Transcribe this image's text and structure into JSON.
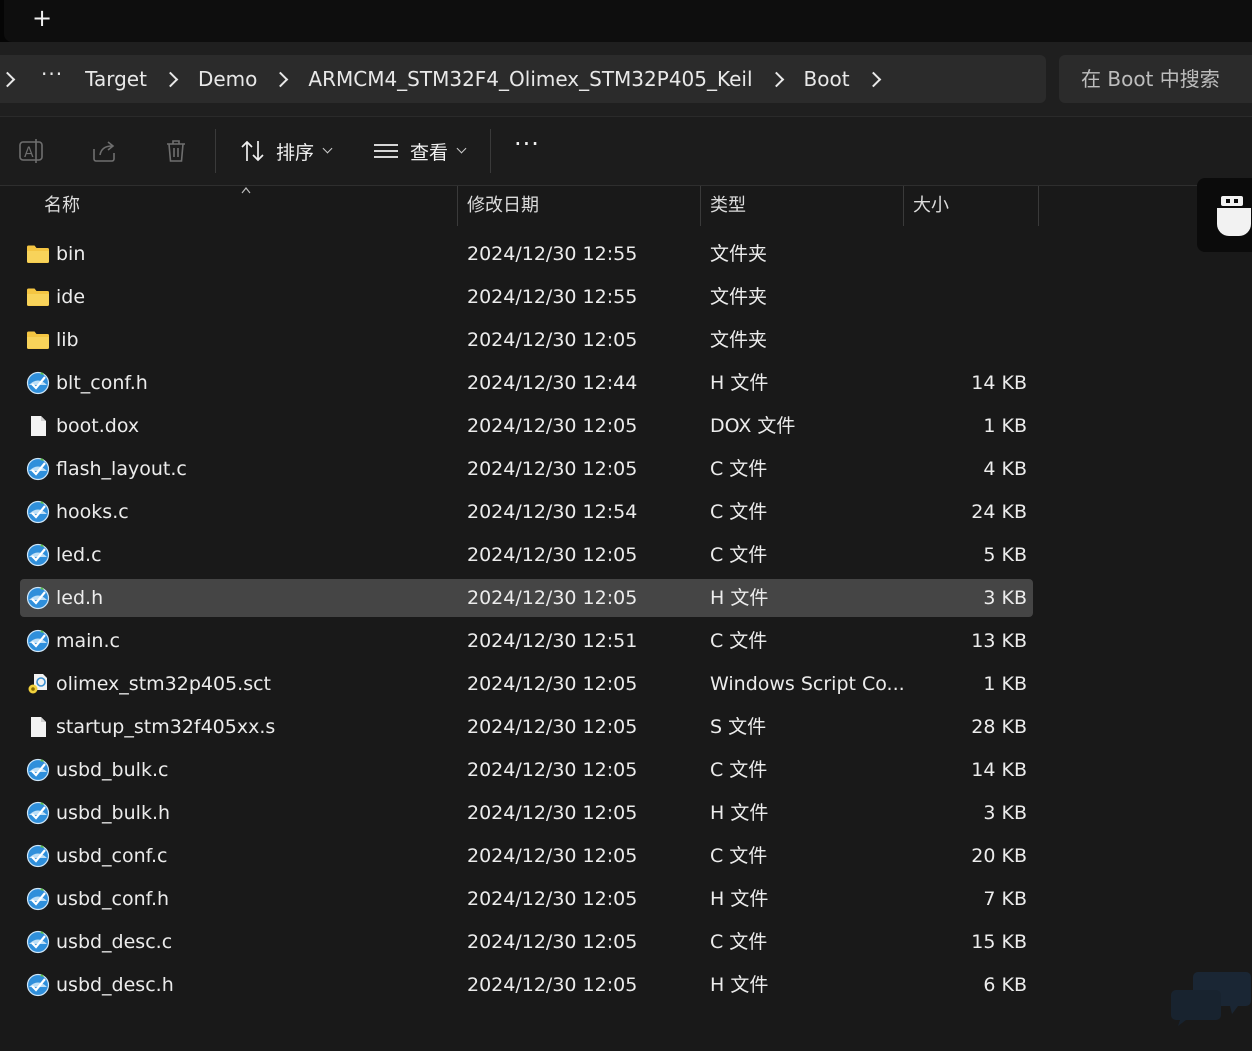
{
  "titlebar": {
    "new_tab_label": "+"
  },
  "breadcrumb": {
    "more": "···",
    "items": [
      "Target",
      "Demo",
      "ARMCM4_STM32F4_Olimex_STM32P405_Keil",
      "Boot"
    ]
  },
  "search": {
    "placeholder": "在 Boot 中搜索"
  },
  "toolbar": {
    "rename_icon": "rename-icon",
    "share_icon": "share-icon",
    "delete_icon": "trash-icon",
    "sort_label": "排序",
    "view_label": "查看",
    "more_label": "···"
  },
  "columns": {
    "name": "名称",
    "date": "修改日期",
    "type": "类型",
    "size": "大小"
  },
  "files": [
    {
      "name": "bin",
      "date": "2024/12/30 12:55",
      "type": "文件夹",
      "size": "",
      "icon": "folder-icon"
    },
    {
      "name": "ide",
      "date": "2024/12/30 12:55",
      "type": "文件夹",
      "size": "",
      "icon": "folder-icon"
    },
    {
      "name": "lib",
      "date": "2024/12/30 12:05",
      "type": "文件夹",
      "size": "",
      "icon": "folder-icon"
    },
    {
      "name": "blt_conf.h",
      "date": "2024/12/30 12:44",
      "type": "H 文件",
      "size": "14 KB",
      "icon": "source-file-icon"
    },
    {
      "name": "boot.dox",
      "date": "2024/12/30 12:05",
      "type": "DOX 文件",
      "size": "1 KB",
      "icon": "blank-file-icon"
    },
    {
      "name": "flash_layout.c",
      "date": "2024/12/30 12:05",
      "type": "C 文件",
      "size": "4 KB",
      "icon": "source-file-icon"
    },
    {
      "name": "hooks.c",
      "date": "2024/12/30 12:54",
      "type": "C 文件",
      "size": "24 KB",
      "icon": "source-file-icon"
    },
    {
      "name": "led.c",
      "date": "2024/12/30 12:05",
      "type": "C 文件",
      "size": "5 KB",
      "icon": "source-file-icon"
    },
    {
      "name": "led.h",
      "date": "2024/12/30 12:05",
      "type": "H 文件",
      "size": "3 KB",
      "icon": "source-file-icon",
      "selected": true
    },
    {
      "name": "main.c",
      "date": "2024/12/30 12:51",
      "type": "C 文件",
      "size": "13 KB",
      "icon": "source-file-icon"
    },
    {
      "name": "olimex_stm32p405.sct",
      "date": "2024/12/30 12:05",
      "type": "Windows Script Co...",
      "size": "1 KB",
      "icon": "script-file-icon"
    },
    {
      "name": "startup_stm32f405xx.s",
      "date": "2024/12/30 12:05",
      "type": "S 文件",
      "size": "28 KB",
      "icon": "blank-file-icon"
    },
    {
      "name": "usbd_bulk.c",
      "date": "2024/12/30 12:05",
      "type": "C 文件",
      "size": "14 KB",
      "icon": "source-file-icon"
    },
    {
      "name": "usbd_bulk.h",
      "date": "2024/12/30 12:05",
      "type": "H 文件",
      "size": "3 KB",
      "icon": "source-file-icon"
    },
    {
      "name": "usbd_conf.c",
      "date": "2024/12/30 12:05",
      "type": "C 文件",
      "size": "20 KB",
      "icon": "source-file-icon"
    },
    {
      "name": "usbd_conf.h",
      "date": "2024/12/30 12:05",
      "type": "H 文件",
      "size": "7 KB",
      "icon": "source-file-icon"
    },
    {
      "name": "usbd_desc.c",
      "date": "2024/12/30 12:05",
      "type": "C 文件",
      "size": "15 KB",
      "icon": "source-file-icon"
    },
    {
      "name": "usbd_desc.h",
      "date": "2024/12/30 12:05",
      "type": "H 文件",
      "size": "6 KB",
      "icon": "source-file-icon"
    }
  ],
  "colors": {
    "background": "#191919",
    "selected_row": "#454545",
    "folder": "#f4c542",
    "source_icon": "#4aa3e8"
  }
}
